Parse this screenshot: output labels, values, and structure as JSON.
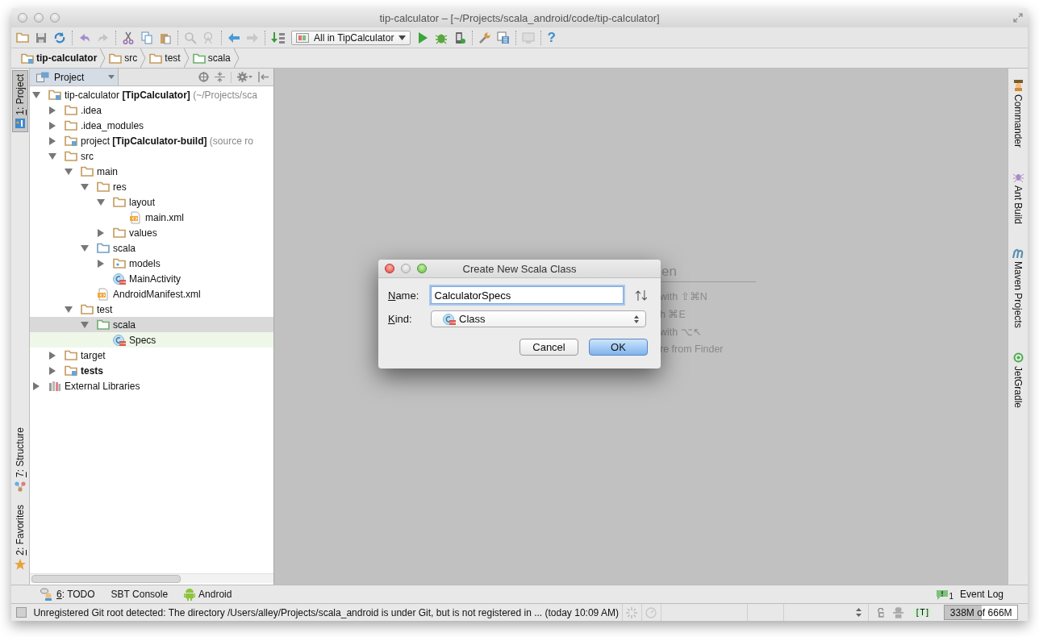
{
  "window": {
    "title": "tip-calculator – [~/Projects/scala_android/code/tip-calculator]"
  },
  "toolbar": {
    "run_configuration": "All in TipCalculator",
    "help": "?"
  },
  "breadcrumbs": [
    {
      "label": "tip-calculator",
      "kind": "module"
    },
    {
      "label": "src",
      "kind": "folder"
    },
    {
      "label": "test",
      "kind": "folder"
    },
    {
      "label": "scala",
      "kind": "test-folder"
    }
  ],
  "left_tool_tabs": [
    {
      "mnemonic": "1",
      "label": ": Project",
      "kind": "project",
      "selected": true
    },
    {
      "mnemonic": "7",
      "label": ": Structure",
      "kind": "structure",
      "selected": false
    },
    {
      "mnemonic": "2",
      "label": ": Favorites",
      "kind": "favorites",
      "selected": false
    }
  ],
  "project_panel": {
    "view": "Project"
  },
  "tree": {
    "items": [
      {
        "label": "tip-calculator ",
        "bold": "[TipCalculator]",
        "note": " (~/Projects/sca",
        "kind": "module",
        "expanded": true,
        "selected": false,
        "highlighted": false,
        "children": [
          {
            "label": ".idea",
            "kind": "folder",
            "expanded": false,
            "selected": false,
            "highlighted": false
          },
          {
            "label": ".idea_modules",
            "kind": "folder",
            "expanded": false,
            "selected": false,
            "highlighted": false
          },
          {
            "label": "project ",
            "bold": "[TipCalculator-build]",
            "note": " (source ro",
            "kind": "module",
            "expanded": false,
            "selected": false,
            "highlighted": false
          },
          {
            "label": "src",
            "kind": "folder",
            "expanded": true,
            "selected": false,
            "highlighted": false,
            "children": [
              {
                "label": "main",
                "kind": "folder",
                "expanded": true,
                "selected": false,
                "highlighted": false,
                "children": [
                  {
                    "label": "res",
                    "kind": "folder",
                    "expanded": true,
                    "selected": false,
                    "highlighted": false,
                    "children": [
                      {
                        "label": "layout",
                        "kind": "folder",
                        "expanded": true,
                        "selected": false,
                        "highlighted": false,
                        "children": [
                          {
                            "label": "main.xml",
                            "kind": "xml",
                            "selected": false,
                            "highlighted": false
                          }
                        ]
                      },
                      {
                        "label": "values",
                        "kind": "folder",
                        "expanded": false,
                        "selected": false,
                        "highlighted": false
                      }
                    ]
                  },
                  {
                    "label": "scala",
                    "kind": "source-folder",
                    "expanded": true,
                    "selected": false,
                    "highlighted": false,
                    "children": [
                      {
                        "label": "models",
                        "kind": "package",
                        "expanded": false,
                        "selected": false,
                        "highlighted": false
                      },
                      {
                        "label": "MainActivity",
                        "kind": "class",
                        "selected": false,
                        "highlighted": false
                      }
                    ]
                  },
                  {
                    "label": "AndroidManifest.xml",
                    "kind": "xml",
                    "selected": false,
                    "highlighted": false
                  }
                ]
              },
              {
                "label": "test",
                "kind": "folder",
                "expanded": true,
                "selected": false,
                "highlighted": false,
                "children": [
                  {
                    "label": "scala",
                    "kind": "test-folder",
                    "expanded": true,
                    "selected": true,
                    "highlighted": false,
                    "children": [
                      {
                        "label": "Specs",
                        "kind": "class",
                        "selected": false,
                        "highlighted": true
                      }
                    ]
                  }
                ]
              }
            ]
          },
          {
            "label": "target",
            "kind": "folder",
            "expanded": false,
            "selected": false,
            "highlighted": false
          },
          {
            "bold": "tests",
            "kind": "module",
            "expanded": false,
            "selected": false,
            "highlighted": false
          }
        ]
      },
      {
        "label": "External Libraries",
        "kind": "libraries",
        "expanded": false,
        "selected": false,
        "highlighted": false
      }
    ]
  },
  "editor_hints": {
    "heading": "en",
    "lines": [
      "with ⇧⌘N",
      "h ⌘E",
      "with ⌥↖",
      "re from Finder"
    ]
  },
  "dialog": {
    "title": "Create New Scala Class",
    "name_label": {
      "mnemonic": "N",
      "label": "ame:"
    },
    "name_value": "CalculatorSpecs",
    "kind_label": {
      "mnemonic": "K",
      "label": "ind:"
    },
    "kind_value": "Class",
    "buttons": [
      {
        "label": "Cancel",
        "default": false
      },
      {
        "label": "OK",
        "default": true
      }
    ]
  },
  "right_tool_tabs": [
    {
      "label": "Commander",
      "kind": "commander"
    },
    {
      "label": "Ant Build",
      "kind": "ant"
    },
    {
      "label": "Maven Projects",
      "kind": "maven"
    },
    {
      "label": "JetGradle",
      "kind": "gradle"
    }
  ],
  "bottom_tool_tabs": [
    {
      "mnemonic": "6",
      "label": ": TODO",
      "kind": "todo"
    },
    {
      "label": "SBT Console",
      "kind": "console"
    },
    {
      "label": "Android",
      "kind": "android"
    }
  ],
  "event_log": {
    "label": "Event Log",
    "count": "1"
  },
  "status_bar": {
    "message": "Unregistered Git root detected: The directory /Users/alley/Projects/scala_android is under Git, but is not registered in ... (today 10:09 AM)",
    "insert_mode": "[T]",
    "memory": {
      "text": "338M of 666M",
      "level": 0.51
    }
  }
}
